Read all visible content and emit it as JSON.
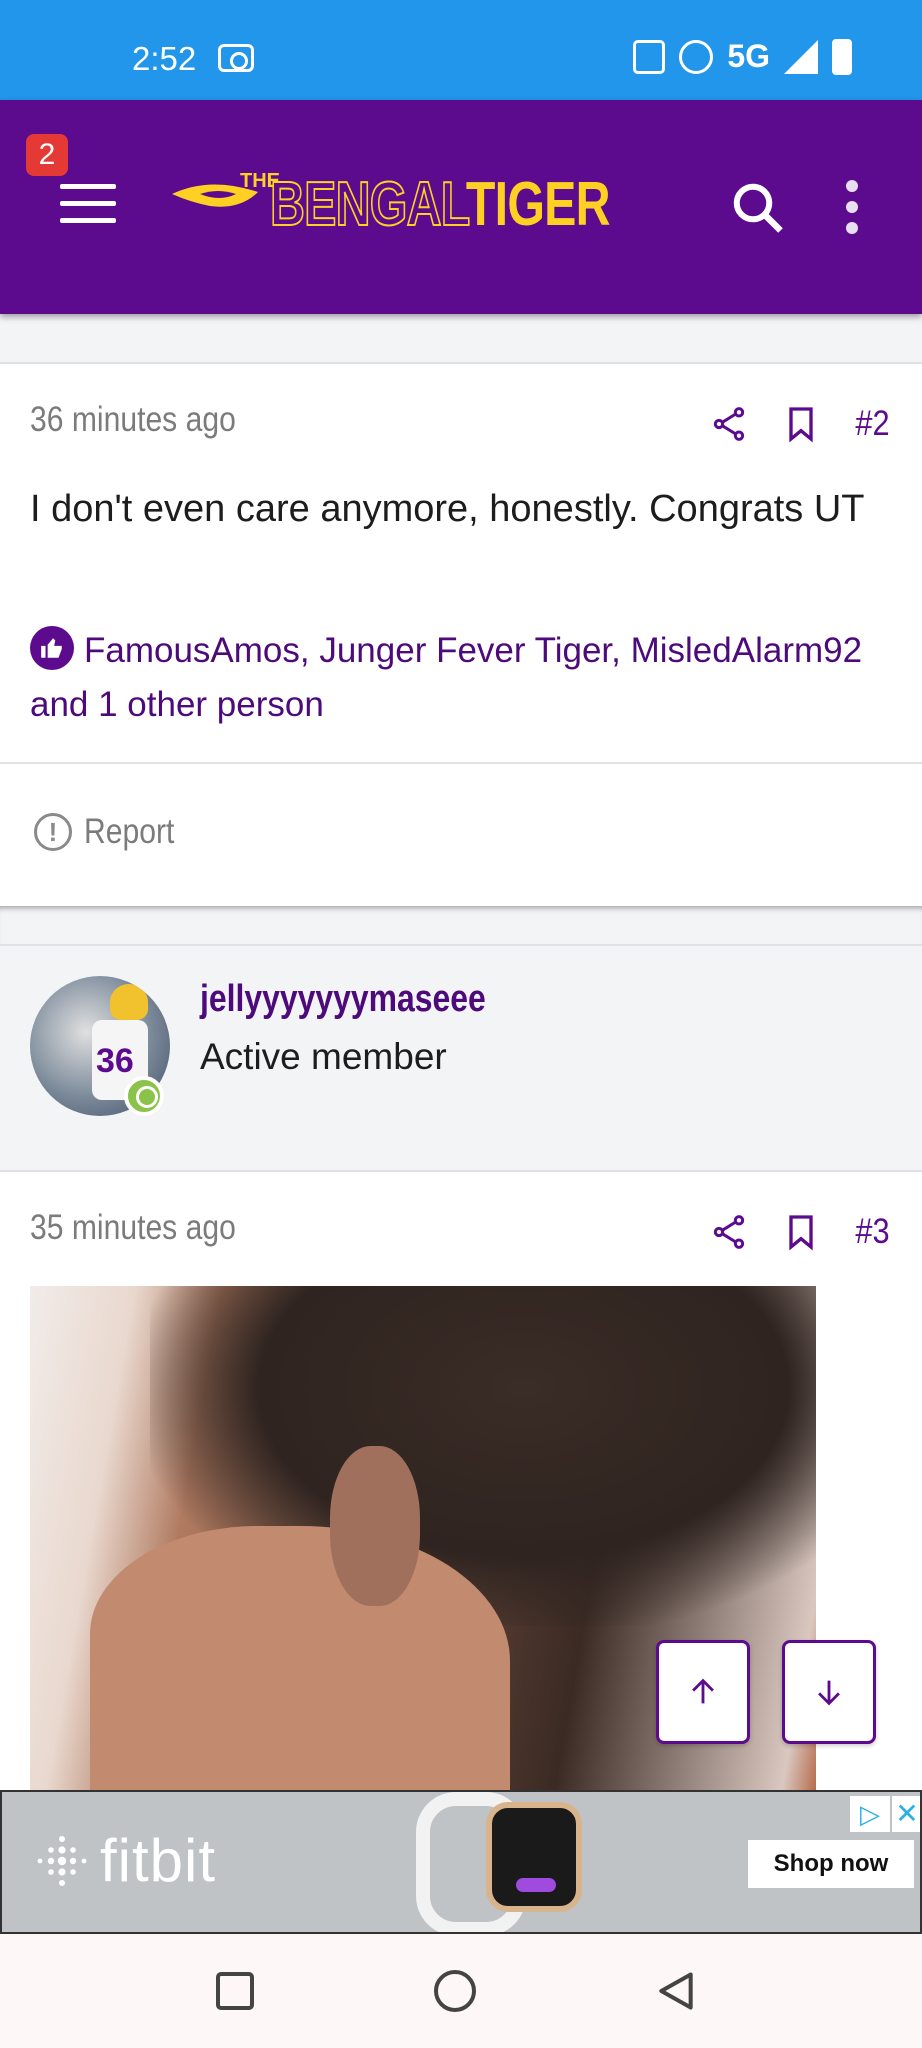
{
  "status_bar": {
    "time": "2:52",
    "network": "5G",
    "icons": [
      "cast-icon",
      "nfc-icon",
      "alarm-icon",
      "signal-icon",
      "battery-charging-icon"
    ]
  },
  "header": {
    "notification_count": "2",
    "logo": {
      "the": "THE",
      "bengal": "BENGAL",
      "tiger": "TIGER"
    },
    "colors": {
      "background": "#5d0b8e",
      "gold": "#fdd023"
    }
  },
  "posts": [
    {
      "time": "36 minutes ago",
      "number": "#2",
      "body": "I don't even care anymore, honestly. Congrats UT",
      "reactions": "FamousAmos, Junger Fever Tiger, MisledAlarm92 and 1 other person",
      "report_label": "Report"
    },
    {
      "author": "jellyyyyyyymaseee",
      "author_title": "Active member",
      "avatar_number": "36",
      "time": "35 minutes ago",
      "number": "#3"
    }
  ],
  "ad": {
    "brand": "fitbit",
    "cta": "Shop now"
  }
}
